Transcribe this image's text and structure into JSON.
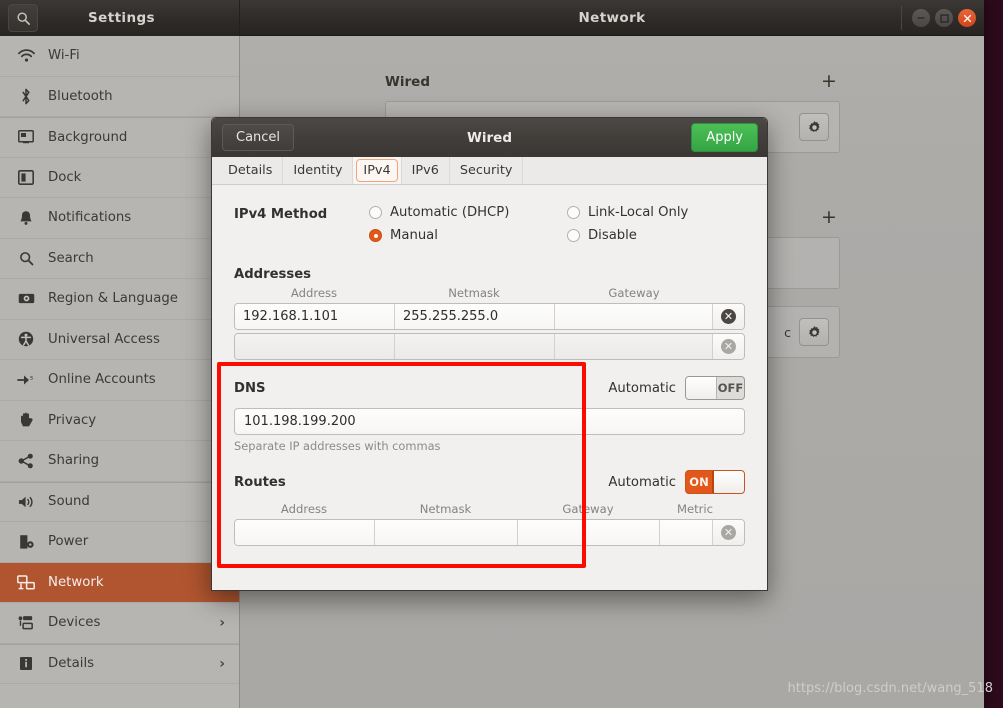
{
  "window": {
    "settings_title": "Settings",
    "panel_title": "Network",
    "search_icon": "search-icon",
    "controls": {
      "minimize": "–",
      "maximize": "□",
      "close": "✕"
    }
  },
  "sidebar": {
    "items": [
      {
        "label": "Wi-Fi",
        "icon": "wifi-icon",
        "chevron": "",
        "active": false
      },
      {
        "label": "Bluetooth",
        "icon": "bluetooth-icon",
        "chevron": "",
        "active": false
      },
      {
        "label": "Background",
        "icon": "background-icon",
        "chevron": "",
        "active": false
      },
      {
        "label": "Dock",
        "icon": "dock-icon",
        "chevron": "",
        "active": false
      },
      {
        "label": "Notifications",
        "icon": "bell-icon",
        "chevron": "",
        "active": false
      },
      {
        "label": "Search",
        "icon": "search-icon",
        "chevron": "",
        "active": false
      },
      {
        "label": "Region & Language",
        "icon": "region-language-icon",
        "chevron": "",
        "active": false
      },
      {
        "label": "Universal Access",
        "icon": "accessibility-icon",
        "chevron": "",
        "active": false
      },
      {
        "label": "Online Accounts",
        "icon": "online-accounts-icon",
        "chevron": "",
        "active": false
      },
      {
        "label": "Privacy",
        "icon": "hand-icon",
        "chevron": "",
        "active": false
      },
      {
        "label": "Sharing",
        "icon": "share-icon",
        "chevron": "",
        "active": false
      },
      {
        "label": "Sound",
        "icon": "speaker-icon",
        "chevron": "",
        "active": false
      },
      {
        "label": "Power",
        "icon": "power-icon",
        "chevron": "",
        "active": false
      },
      {
        "label": "Network",
        "icon": "network-icon",
        "chevron": "",
        "active": true
      },
      {
        "label": "Devices",
        "icon": "devices-icon",
        "chevron": "›",
        "active": false
      },
      {
        "label": "Details",
        "icon": "info-icon",
        "chevron": "›",
        "active": false
      }
    ]
  },
  "main": {
    "sections": [
      {
        "title": "Wired",
        "add_label": "+",
        "card_text": "",
        "gear": "gear-icon"
      },
      {
        "title": "",
        "add_label": "+",
        "card_text": "",
        "gear": ""
      },
      {
        "title": "",
        "add_label": "",
        "card_text": "c",
        "gear": "gear-icon"
      }
    ]
  },
  "dialog": {
    "title": "Wired",
    "cancel_label": "Cancel",
    "apply_label": "Apply",
    "tabs": [
      {
        "label": "Details",
        "selected": false
      },
      {
        "label": "Identity",
        "selected": false
      },
      {
        "label": "IPv4",
        "selected": true
      },
      {
        "label": "IPv6",
        "selected": false
      },
      {
        "label": "Security",
        "selected": false
      }
    ],
    "ipv4_method": {
      "label": "IPv4 Method",
      "options": [
        {
          "label": "Automatic (DHCP)",
          "selected": false
        },
        {
          "label": "Link-Local Only",
          "selected": false
        },
        {
          "label": "Manual",
          "selected": true
        },
        {
          "label": "Disable",
          "selected": false
        }
      ]
    },
    "addresses": {
      "title": "Addresses",
      "columns": [
        "Address",
        "Netmask",
        "Gateway"
      ],
      "rows": [
        {
          "address": "192.168.1.101",
          "netmask": "255.255.255.0",
          "gateway": ""
        },
        {
          "address": "",
          "netmask": "",
          "gateway": ""
        }
      ]
    },
    "dns": {
      "title": "DNS",
      "automatic_label": "Automatic",
      "automatic_state": "OFF",
      "value": "101.198.199.200",
      "placeholder": "",
      "hint": "Separate IP addresses with commas"
    },
    "routes": {
      "title": "Routes",
      "automatic_label": "Automatic",
      "automatic_state": "ON",
      "columns": [
        "Address",
        "Netmask",
        "Gateway",
        "Metric"
      ],
      "rows": [
        {
          "address": "",
          "netmask": "",
          "gateway": "",
          "metric": ""
        }
      ]
    }
  },
  "annotation": {
    "highlight_color": "#fb0b00"
  },
  "watermark": {
    "text": "https://blog.csdn.net/wang_518"
  }
}
